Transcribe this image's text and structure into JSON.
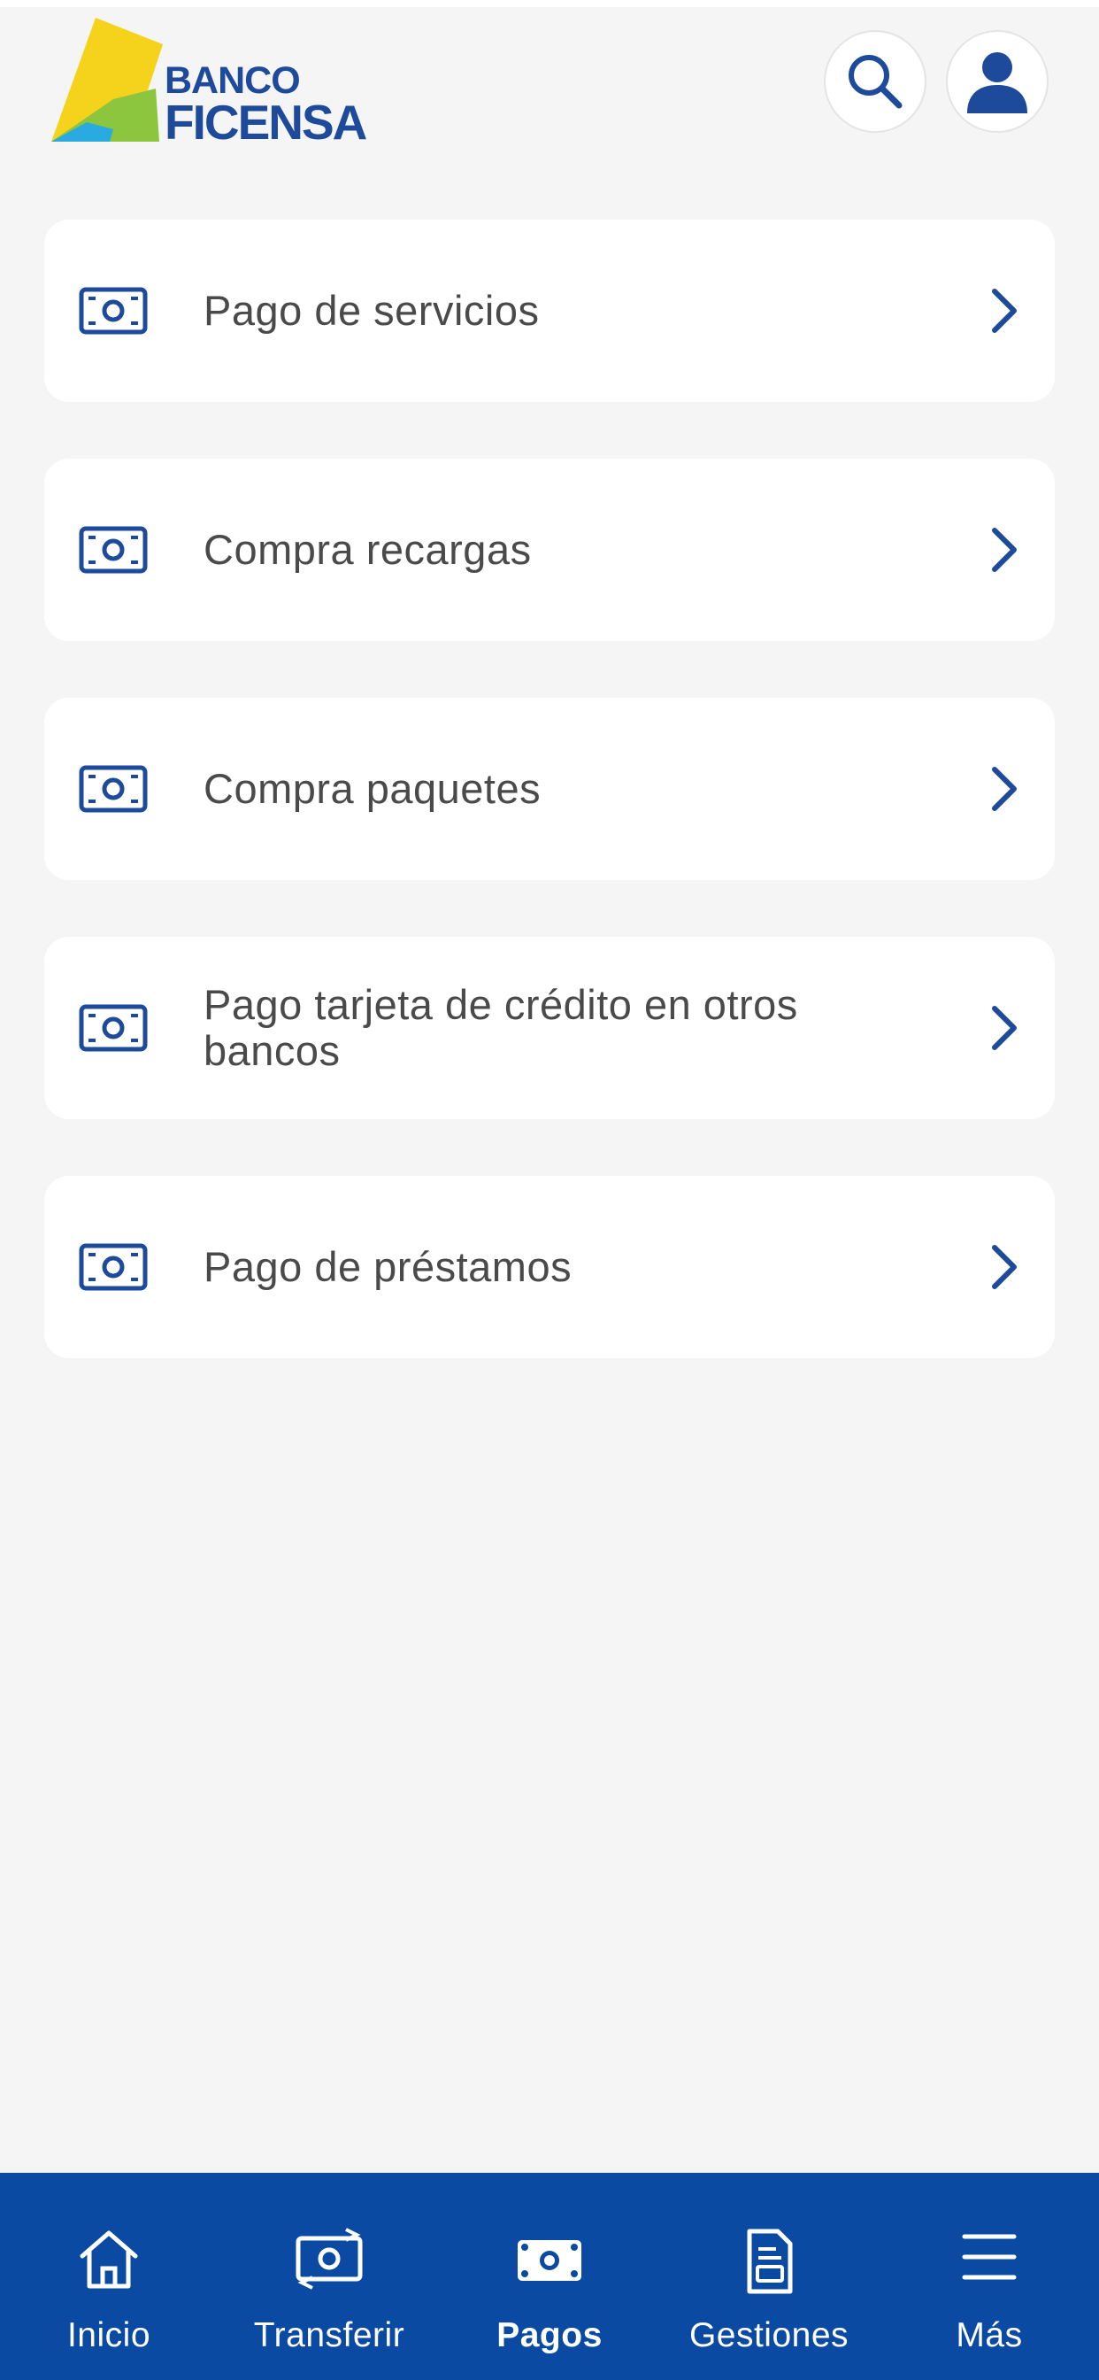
{
  "brand": {
    "line1": "BANCO",
    "line2": "FICENSA",
    "colors": {
      "primary": "#1e4a9c",
      "yellow": "#f5d31c",
      "green": "#8cc63f",
      "teal": "#29abe2"
    }
  },
  "header": {
    "search_icon": "search-icon",
    "profile_icon": "user-icon"
  },
  "menu": {
    "items": [
      {
        "label": "Pago de servicios",
        "icon": "money-bill-icon"
      },
      {
        "label": "Compra recargas",
        "icon": "money-bill-icon"
      },
      {
        "label": "Compra paquetes",
        "icon": "money-bill-icon"
      },
      {
        "label": "Pago tarjeta de crédito en otros bancos",
        "icon": "money-bill-icon"
      },
      {
        "label": "Pago de préstamos",
        "icon": "money-bill-icon"
      }
    ]
  },
  "bottom_nav": {
    "background": "#0b4aa2",
    "items": [
      {
        "label": "Inicio",
        "icon": "home-icon"
      },
      {
        "label": "Transferir",
        "icon": "transfer-icon"
      },
      {
        "label": "Pagos",
        "icon": "money-bill-filled-icon",
        "active": true
      },
      {
        "label": "Gestiones",
        "icon": "document-icon"
      },
      {
        "label": "Más",
        "icon": "menu-icon"
      }
    ]
  }
}
